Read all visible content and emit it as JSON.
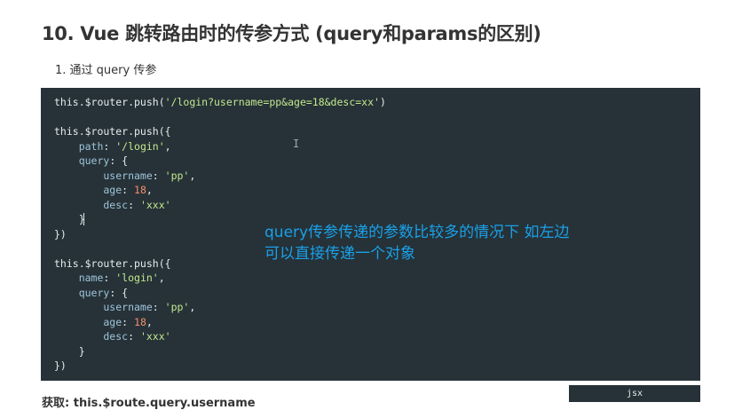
{
  "heading": "10. Vue 跳转路由时的传参方式 (query和params的区别)",
  "list_item": "1. 通过 query 传参",
  "code_lines": [
    [
      {
        "t": "this.$router.push(",
        "c": "plain"
      },
      {
        "t": "'/login?username=pp&age=18&desc=xx'",
        "c": "str"
      },
      {
        "t": ")",
        "c": "plain"
      }
    ],
    [],
    [
      {
        "t": "this.$router.push({",
        "c": "plain"
      }
    ],
    [
      {
        "t": "    path",
        "c": "prop"
      },
      {
        "t": ": ",
        "c": "plain"
      },
      {
        "t": "'/login'",
        "c": "str"
      },
      {
        "t": ",",
        "c": "plain"
      }
    ],
    [
      {
        "t": "    query",
        "c": "prop"
      },
      {
        "t": ": {",
        "c": "plain"
      }
    ],
    [
      {
        "t": "        username",
        "c": "prop"
      },
      {
        "t": ": ",
        "c": "plain"
      },
      {
        "t": "'pp'",
        "c": "str"
      },
      {
        "t": ",",
        "c": "plain"
      }
    ],
    [
      {
        "t": "        age",
        "c": "prop"
      },
      {
        "t": ": ",
        "c": "plain"
      },
      {
        "t": "18",
        "c": "num"
      },
      {
        "t": ",",
        "c": "plain"
      }
    ],
    [
      {
        "t": "        desc",
        "c": "prop"
      },
      {
        "t": ": ",
        "c": "plain"
      },
      {
        "t": "'xxx'",
        "c": "str"
      }
    ],
    [
      {
        "t": "    }",
        "c": "plain"
      }
    ],
    [
      {
        "t": "})",
        "c": "plain"
      }
    ],
    [],
    [
      {
        "t": "this.$router.push({",
        "c": "plain"
      }
    ],
    [
      {
        "t": "    name",
        "c": "prop"
      },
      {
        "t": ": ",
        "c": "plain"
      },
      {
        "t": "'login'",
        "c": "str"
      },
      {
        "t": ",",
        "c": "plain"
      }
    ],
    [
      {
        "t": "    query",
        "c": "prop"
      },
      {
        "t": ": {",
        "c": "plain"
      }
    ],
    [
      {
        "t": "        username",
        "c": "prop"
      },
      {
        "t": ": ",
        "c": "plain"
      },
      {
        "t": "'pp'",
        "c": "str"
      },
      {
        "t": ",",
        "c": "plain"
      }
    ],
    [
      {
        "t": "        age",
        "c": "prop"
      },
      {
        "t": ": ",
        "c": "plain"
      },
      {
        "t": "18",
        "c": "num"
      },
      {
        "t": ",",
        "c": "plain"
      }
    ],
    [
      {
        "t": "        desc",
        "c": "prop"
      },
      {
        "t": ": ",
        "c": "plain"
      },
      {
        "t": "'xxx'",
        "c": "str"
      }
    ],
    [
      {
        "t": "    }",
        "c": "plain"
      }
    ],
    [
      {
        "t": "})",
        "c": "plain"
      }
    ]
  ],
  "annotation": {
    "line1": "query传参传递的参数比较多的情况下  如左边",
    "line2": "可以直接传递一个对象"
  },
  "code_language": "jsx",
  "footer": "获取: this.$route.query.username",
  "colors": {
    "code_bg": "#263238",
    "annotation": "#1aa0e8",
    "string": "#c3e88d",
    "number": "#f78c6c",
    "property": "#9fc4da"
  }
}
